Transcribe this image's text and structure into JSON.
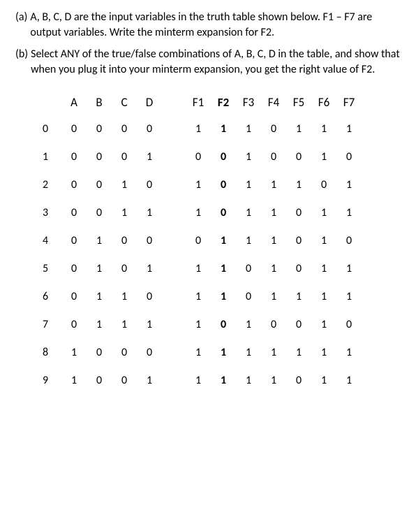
{
  "problems": {
    "a": {
      "label": "(a)",
      "text": "A, B, C, D are the input variables in the truth table shown below.  F1 – F7 are output variables.  Write the minterm expansion for F2."
    },
    "b": {
      "label": "(b)",
      "text": "Select ANY of the true/false combinations of A, B, C, D in the table, and show that when you plug it into your minterm expansion, you get the right value of F2."
    }
  },
  "table": {
    "headers": {
      "inputs": [
        "A",
        "B",
        "C",
        "D"
      ],
      "outputs": [
        "F1",
        "F2",
        "F3",
        "F4",
        "F5",
        "F6",
        "F7"
      ]
    },
    "rows": [
      {
        "idx": "0",
        "in": [
          "0",
          "0",
          "0",
          "0"
        ],
        "out": [
          "1",
          "1",
          "1",
          "0",
          "1",
          "1",
          "1"
        ]
      },
      {
        "idx": "1",
        "in": [
          "0",
          "0",
          "0",
          "1"
        ],
        "out": [
          "0",
          "0",
          "1",
          "0",
          "0",
          "1",
          "0"
        ]
      },
      {
        "idx": "2",
        "in": [
          "0",
          "0",
          "1",
          "0"
        ],
        "out": [
          "1",
          "0",
          "1",
          "1",
          "1",
          "0",
          "1"
        ]
      },
      {
        "idx": "3",
        "in": [
          "0",
          "0",
          "1",
          "1"
        ],
        "out": [
          "1",
          "0",
          "1",
          "1",
          "0",
          "1",
          "1"
        ]
      },
      {
        "idx": "4",
        "in": [
          "0",
          "1",
          "0",
          "0"
        ],
        "out": [
          "0",
          "1",
          "1",
          "1",
          "0",
          "1",
          "0"
        ]
      },
      {
        "idx": "5",
        "in": [
          "0",
          "1",
          "0",
          "1"
        ],
        "out": [
          "1",
          "1",
          "0",
          "1",
          "0",
          "1",
          "1"
        ]
      },
      {
        "idx": "6",
        "in": [
          "0",
          "1",
          "1",
          "0"
        ],
        "out": [
          "1",
          "1",
          "0",
          "1",
          "1",
          "1",
          "1"
        ]
      },
      {
        "idx": "7",
        "in": [
          "0",
          "1",
          "1",
          "1"
        ],
        "out": [
          "1",
          "0",
          "1",
          "0",
          "0",
          "1",
          "0"
        ]
      },
      {
        "idx": "8",
        "in": [
          "1",
          "0",
          "0",
          "0"
        ],
        "out": [
          "1",
          "1",
          "1",
          "1",
          "1",
          "1",
          "1"
        ]
      },
      {
        "idx": "9",
        "in": [
          "1",
          "0",
          "0",
          "1"
        ],
        "out": [
          "1",
          "1",
          "1",
          "1",
          "0",
          "1",
          "1"
        ]
      }
    ]
  }
}
